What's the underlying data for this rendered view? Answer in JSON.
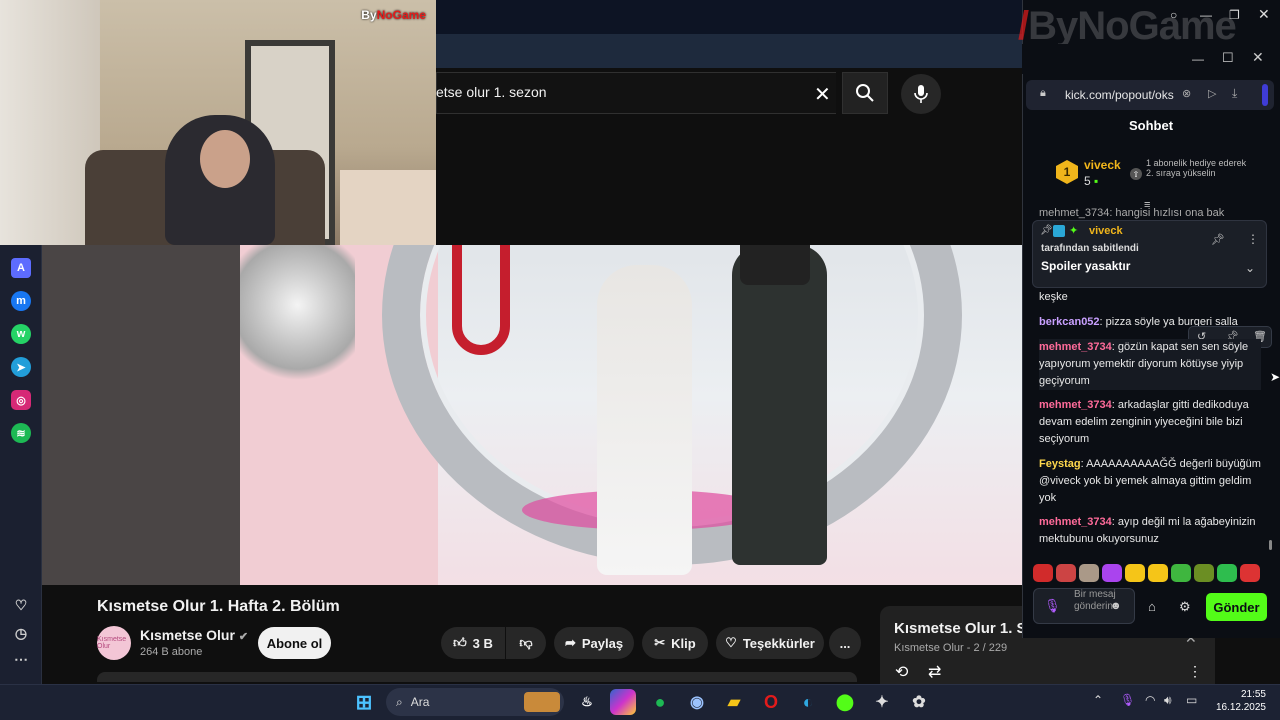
{
  "webcam": {
    "logo_prefix": "By",
    "logo_suffix": "NoGame"
  },
  "youtube": {
    "search_query": "etse olur 1. sezon",
    "video_title": "Kısmetse Olur 1. Hafta 2. Bölüm",
    "channel_name": "Kısmetse Olur",
    "channel_avatar_text": "Kısmetse Olur",
    "channel_subs": "264 B abone",
    "subscribe_label": "Abone ol",
    "like_count": "3 B",
    "share_label": "Paylaş",
    "clip_label": "Klip",
    "thanks_label": "Teşekkürler",
    "more_label": "...",
    "playlist_title": "Kısmetse Olur 1. S",
    "playlist_sub": "Kısmetse Olur - 2 / 229"
  },
  "watermark": {
    "prefix": "By",
    "suffix": "NoGame"
  },
  "chat": {
    "url": "kick.com/popout/oks",
    "header": "Sohbet",
    "gifter_rank": "1",
    "gifter_name": "viveck",
    "gifter_count": "5",
    "gift_text": "1 abonelik hediye ederek 2. sıraya yükselin",
    "partial_msg": "mehmet_3734: hangisi hızlısı ona bak",
    "pinned_user": "viveck",
    "pinned_by": "tarafından sabitlendi",
    "pinned_text": "Spoiler yasaktır",
    "messages": [
      {
        "user": "",
        "text": "keşke",
        "color": "#e8e8e8"
      },
      {
        "user": "berkcan052",
        "text": "pizza söyle ya burgeri salla",
        "color": "#c9a0ff"
      },
      {
        "user": "mehmet_3734",
        "text": "gözün kapat sen sen söyle yapıyorum yemektir diyorum kötüyse yiyip geçiyorum",
        "color": "#ff6b9a"
      },
      {
        "user": "mehmet_3734",
        "text": "arkadaşlar gitti dedikoduya devam edelim zenginin yiyeceğini bile bizi seçiyorum",
        "color": "#ff6b9a"
      },
      {
        "user": "Feystag",
        "text": "AAAAAAAAAAĞĞ değerli büyüğüm @viveck yok bi yemek almaya gittim geldim yok",
        "color": "#ffd84d"
      },
      {
        "user": "mehmet_3734",
        "text": "ayıp değil mi la ağabeyinizin mektubunu okuyorsunuz",
        "color": "#ff6b9a"
      }
    ],
    "input_placeholder": "Bir mesaj gönderin",
    "send_label": "Gönder"
  },
  "taskbar": {
    "search_label": "Ara",
    "time": "21:55",
    "date": "16.12.2025"
  },
  "colors": {
    "kick_green": "#53fc18",
    "yt_bg": "#0f0f0f",
    "brand_red": "#e31b1b"
  }
}
